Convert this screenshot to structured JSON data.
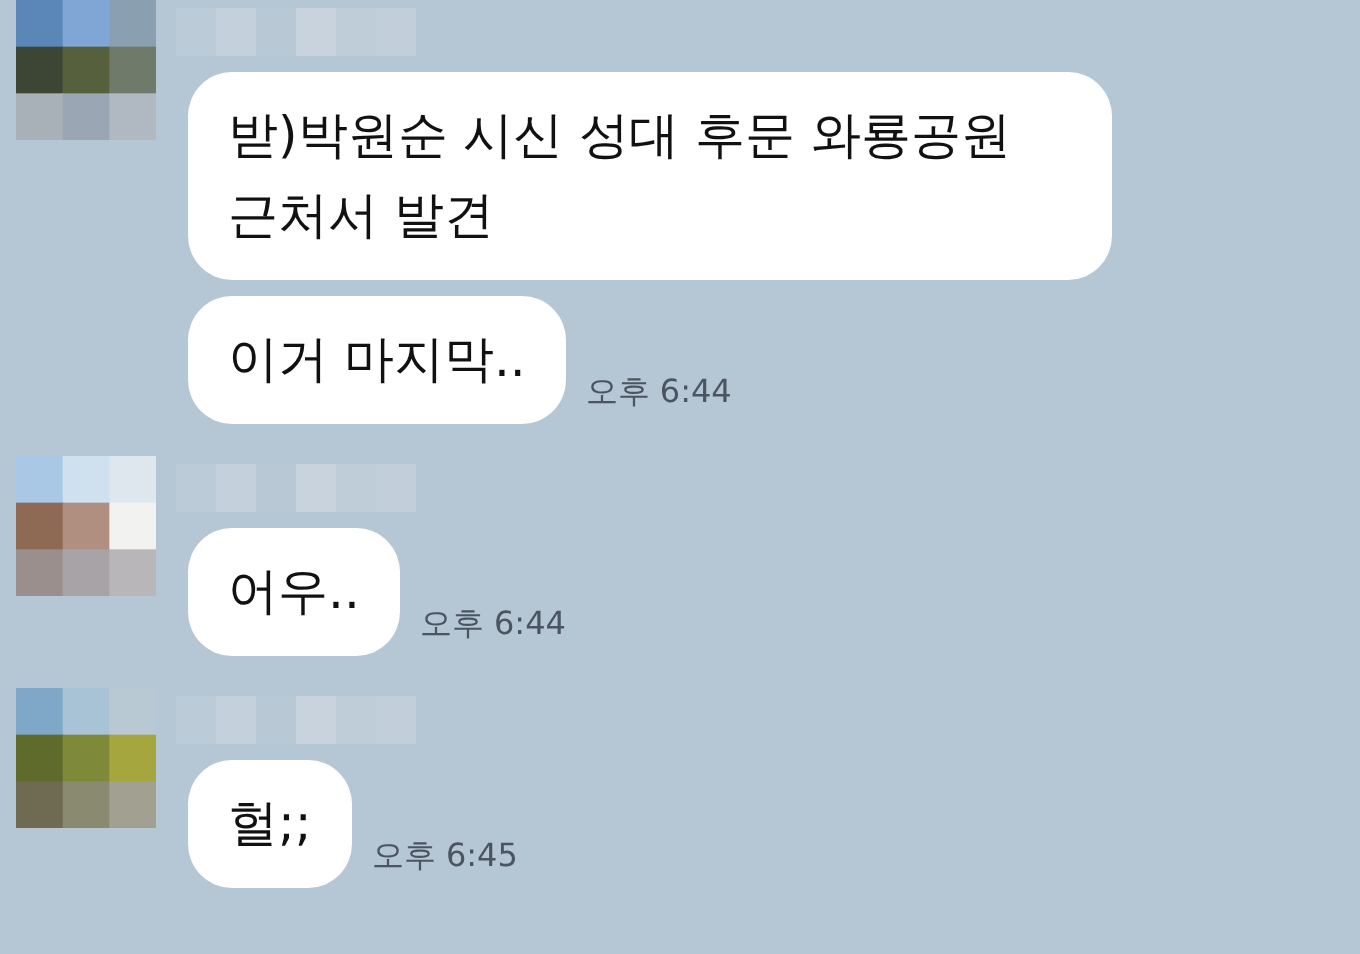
{
  "groups": [
    {
      "avatar": {
        "kind": "picture"
      },
      "messages": [
        {
          "text": "받)박원순 시신 성대 후문 와룡공원 근처서 발견"
        },
        {
          "text": "이거 마지막..",
          "time": "오후 6:44"
        }
      ]
    },
    {
      "avatar": {
        "kind": "picture"
      },
      "messages": [
        {
          "text": "어우..",
          "time": "오후 6:44"
        }
      ]
    },
    {
      "avatar": {
        "kind": "picture"
      },
      "messages": [
        {
          "text": "헐;;",
          "time": "오후 6:45"
        }
      ]
    }
  ]
}
